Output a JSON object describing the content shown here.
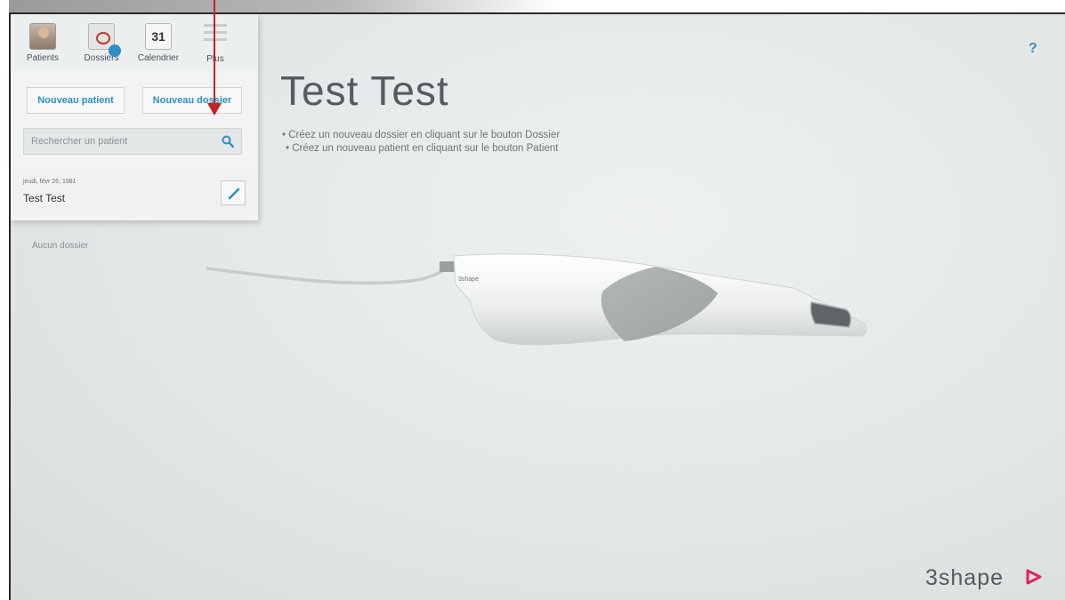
{
  "tabs": [
    {
      "label": "Patients",
      "icon": "patient-photo-icon"
    },
    {
      "label": "Dossiers",
      "icon": "dossier-icon"
    },
    {
      "label": "Calendrier",
      "icon": "calendar-icon",
      "icon_text": "31"
    },
    {
      "label": "Plus",
      "icon": "menu-icon"
    }
  ],
  "actions": {
    "new_patient": "Nouveau patient",
    "new_dossier": "Nouveau dossier"
  },
  "search": {
    "placeholder": "Rechercher un patient",
    "icon": "search-icon"
  },
  "patient": {
    "date": "jeudi, févr 26, 1981",
    "name": "Test Test"
  },
  "no_dossier": "Aucun dossier",
  "main": {
    "title": "Test Test",
    "instructions": [
      "Créez un nouveau dossier en cliquant sur le bouton Dossier",
      "Créez un nouveau patient en cliquant sur le bouton Patient"
    ]
  },
  "help_label": "?",
  "scanner_label": "3shape",
  "brand": "3shape",
  "colors": {
    "accent": "#2e8fc4",
    "brand_triangle": "#e0245e",
    "annotation_arrow": "#c42222"
  }
}
